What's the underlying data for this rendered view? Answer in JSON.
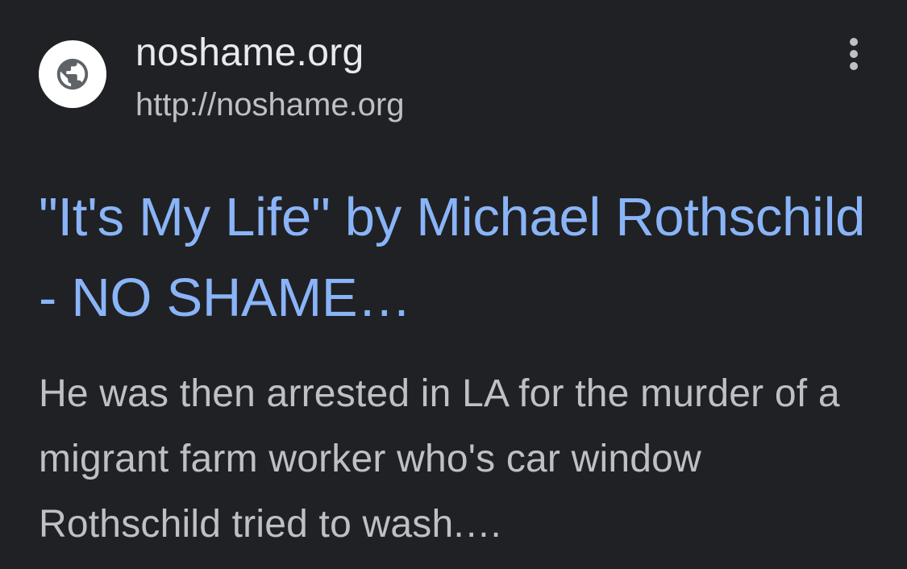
{
  "site": {
    "name": "noshame.org",
    "url": "http://noshame.org",
    "favicon_icon": "globe-icon",
    "menu_icon": "more-vert-icon"
  },
  "result": {
    "title": "\"It's My Life\" by Michael Rothschild - NO SHAME…",
    "snippet": "He was then arrested in LA for the murder of a migrant farm worker who's car window Rothschild tried to wash.…"
  },
  "colors": {
    "background": "#202124",
    "title_link": "#8ab4f8",
    "primary_text": "#e8eaed",
    "secondary_text": "#bdc1c6"
  }
}
